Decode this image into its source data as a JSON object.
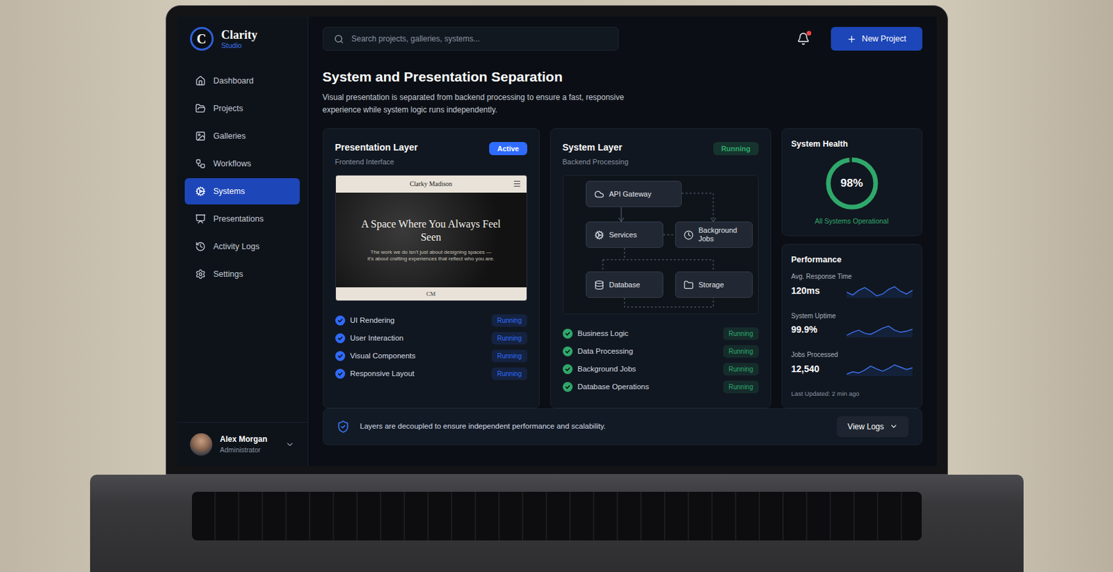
{
  "sidebar": {
    "logo_letter": "C",
    "brand": "Clarity",
    "brand_sub": "Studio",
    "items": [
      {
        "label": "Dashboard",
        "selected": false
      },
      {
        "label": "Projects",
        "selected": false
      },
      {
        "label": "Galleries",
        "selected": false
      },
      {
        "label": "Workflows",
        "selected": false
      },
      {
        "label": "Systems",
        "selected": true
      },
      {
        "label": "Presentations",
        "selected": false
      },
      {
        "label": "Activity Logs",
        "selected": false
      },
      {
        "label": "Settings",
        "selected": false
      }
    ],
    "user": {
      "name": "Alex Morgan",
      "role": "Administrator"
    }
  },
  "header": {
    "search_placeholder": "Search projects, galleries, systems...",
    "notifications_unread": true,
    "new_project_button": "New Project"
  },
  "page": {
    "title": "System and Presentation Separation",
    "description": "Visual presentation is separated from backend processing to ensure a fast, responsive experience while system logic runs independently."
  },
  "layers": [
    {
      "kind": "preview",
      "title": "Presentation Layer",
      "subtitle": "Frontend Interface",
      "badge": "Active",
      "badge_filled": true,
      "color": "#2f6bff",
      "preview": {
        "logo": "Clarky Madison",
        "heading": "A Space Where You Always Feel Seen",
        "body": "The work we do isn't just about designing spaces — it's about crafting experiences that reflect who you are.",
        "footer": "CM"
      },
      "checks": [
        {
          "label": "UI Rendering",
          "status": "Running",
          "checked": true
        },
        {
          "label": "User Interaction",
          "status": "Running",
          "checked": true
        },
        {
          "label": "Visual Components",
          "status": "Running",
          "checked": true
        },
        {
          "label": "Responsive Layout",
          "status": "Running",
          "checked": true
        }
      ]
    },
    {
      "kind": "diagram",
      "title": "System Layer",
      "subtitle": "Backend Processing",
      "badge": "Running",
      "badge_filled": false,
      "color": "#2fa86b",
      "diagram": {
        "nodes": [
          "API Gateway",
          "Services",
          "Background Jobs",
          "Database",
          "Storage"
        ]
      },
      "checks": [
        {
          "label": "Business Logic",
          "status": "Running",
          "checked": true
        },
        {
          "label": "Data Processing",
          "status": "Running",
          "checked": true
        },
        {
          "label": "Background Jobs",
          "status": "Running",
          "checked": true
        },
        {
          "label": "Database Operations",
          "status": "Running",
          "checked": true
        }
      ]
    }
  ],
  "health": {
    "title": "System Health",
    "value": "98%",
    "level": 0.98,
    "caption": "All Systems Operational"
  },
  "performance": {
    "title": "Performance",
    "metrics": [
      {
        "label": "Avg. Response Time",
        "value": "120ms",
        "series": [
          121,
          118,
          123,
          126,
          122,
          117,
          119,
          124,
          127,
          122,
          119,
          123
        ]
      },
      {
        "label": "System Uptime",
        "value": "99.9%",
        "series": [
          99.85,
          99.88,
          99.9,
          99.87,
          99.86,
          99.89,
          99.92,
          99.94,
          99.9,
          99.88,
          99.89,
          99.91
        ]
      },
      {
        "label": "Jobs Processed",
        "value": "12,540",
        "series": [
          12380,
          12420,
          12400,
          12450,
          12520,
          12470,
          12430,
          12480,
          12540,
          12500,
          12460,
          12490
        ]
      }
    ],
    "updated": "Last Updated: 2 min ago"
  },
  "banner": {
    "text": "Layers are decoupled to ensure independent performance and scalability.",
    "button": "View Logs"
  }
}
